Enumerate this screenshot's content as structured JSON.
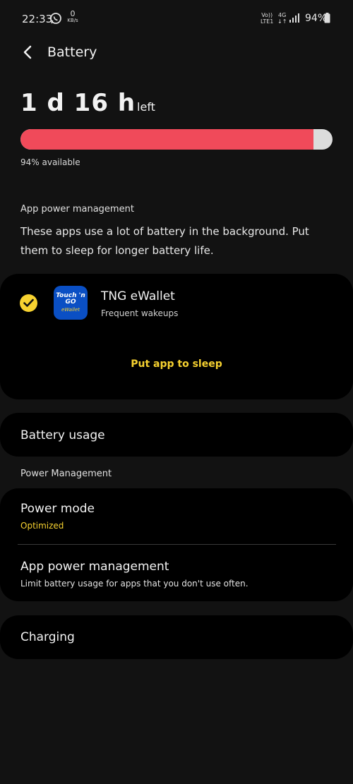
{
  "status_bar": {
    "time": "22:33",
    "net_speed_value": "0",
    "net_speed_unit": "KB/s",
    "volte_top": "Vo))",
    "volte_bottom": "LTE1",
    "network_top": "4G",
    "network_bottom": "↓↑",
    "battery_percent": "94%",
    "icons": [
      "whatsapp-icon",
      "signal-icon",
      "battery-icon"
    ]
  },
  "header": {
    "title": "Battery",
    "back_icon": "back-arrow-icon"
  },
  "summary": {
    "time_left": "1 d 16 h",
    "time_left_suffix": "left",
    "battery_level": 0.94,
    "available_text": "94% available"
  },
  "app_power_management": {
    "heading": "App power management",
    "description": "These apps use a lot of battery in the background. Put them to sleep for longer battery life.",
    "apps": [
      {
        "name": "TNG eWallet",
        "detail": "Frequent wakeups",
        "checked": true,
        "icon_text_top": "Touch 'n GO",
        "icon_text_bottom": "eWallet"
      }
    ],
    "action_label": "Put app to sleep"
  },
  "battery_usage": {
    "label": "Battery usage"
  },
  "power_management": {
    "heading": "Power Management",
    "power_mode": {
      "label": "Power mode",
      "value": "Optimized"
    },
    "app_power": {
      "label": "App power management",
      "sublabel": "Limit battery usage for apps that you don't use often."
    }
  },
  "charging": {
    "label": "Charging"
  },
  "colors": {
    "accent_yellow": "#f7d230",
    "battery_fill": "#f04a5a",
    "background": "#121212",
    "card": "#000000"
  }
}
